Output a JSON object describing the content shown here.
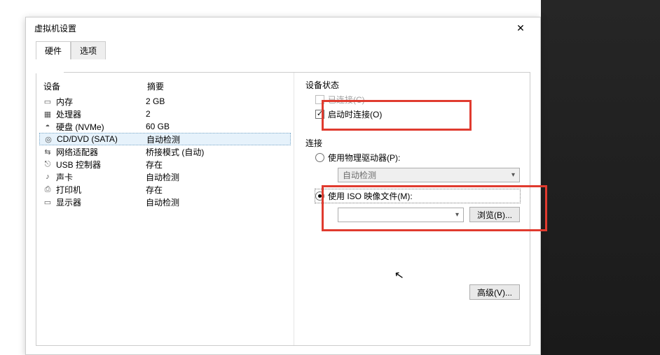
{
  "dialog": {
    "title": "虚拟机设置",
    "close_glyph": "✕"
  },
  "tabs": {
    "hardware": "硬件",
    "options": "选项"
  },
  "table": {
    "header_device": "设备",
    "header_summary": "摘要",
    "rows": [
      {
        "key": "memory",
        "icon": "▭",
        "name": "内存",
        "summary": "2 GB"
      },
      {
        "key": "cpu",
        "icon": "▦",
        "name": "处理器",
        "summary": "2"
      },
      {
        "key": "disk",
        "icon": "◓",
        "name": "硬盘 (NVMe)",
        "summary": "60 GB"
      },
      {
        "key": "cddvd",
        "icon": "◎",
        "name": "CD/DVD (SATA)",
        "summary": "自动检测"
      },
      {
        "key": "net",
        "icon": "⇆",
        "name": "网络适配器",
        "summary": "桥接模式 (自动)"
      },
      {
        "key": "usb",
        "icon": "⎋",
        "name": "USB 控制器",
        "summary": "存在"
      },
      {
        "key": "sound",
        "icon": "♪",
        "name": "声卡",
        "summary": "自动检测"
      },
      {
        "key": "printer",
        "icon": "⎙",
        "name": "打印机",
        "summary": "存在"
      },
      {
        "key": "display",
        "icon": "▭",
        "name": "显示器",
        "summary": "自动检测"
      }
    ]
  },
  "right": {
    "status_label": "设备状态",
    "connected_label": "已连接(C)",
    "connect_on_start_label": "启动时连接(O)",
    "connection_label": "连接",
    "use_physical_label": "使用物理驱动器(P):",
    "physical_value": "自动检测",
    "use_iso_label": "使用 ISO 映像文件(M):",
    "iso_value": "",
    "browse_label": "浏览(B)...",
    "advanced_label": "高级(V)..."
  },
  "state": {
    "selected_device_key": "cddvd",
    "connected_checked": false,
    "connected_enabled": false,
    "connect_on_start_checked": true,
    "radio_selected": "iso"
  }
}
